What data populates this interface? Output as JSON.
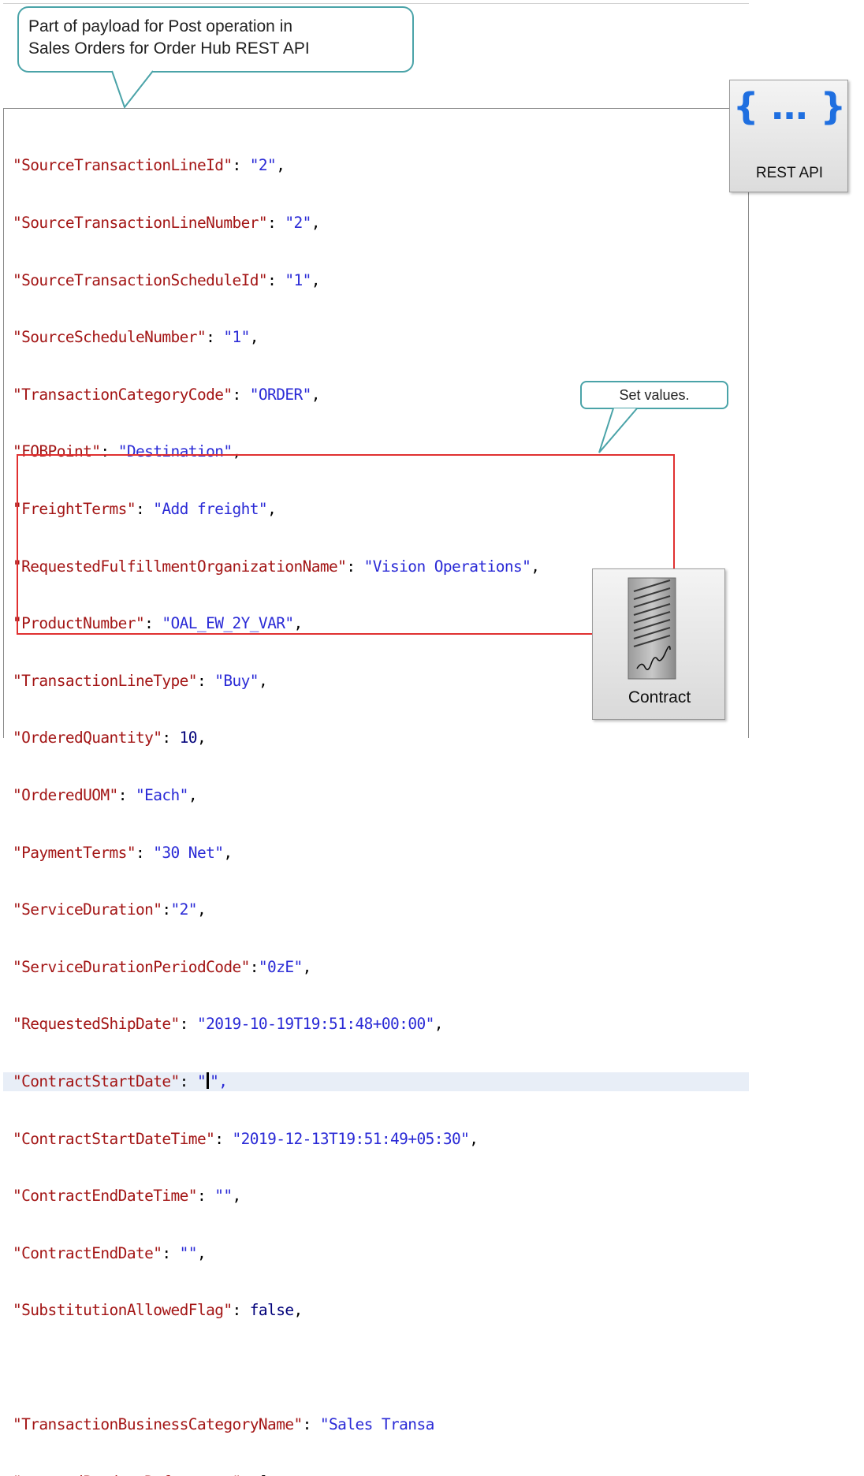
{
  "callouts": {
    "main_line1": "Part of payload for Post operation in",
    "main_line2": "Sales Orders for Order Hub REST API",
    "set_values": "Set values."
  },
  "tiles": {
    "rest_glyph": "{ … }",
    "rest_label": "REST API",
    "contract_label": "Contract",
    "rest_icon": "curly-braces-icon",
    "contract_icon": "signed-document-icon"
  },
  "colors": {
    "key": "#a31515",
    "string": "#2a2ad6",
    "callout_border": "#4aa3a8",
    "highlight_box": "#e03030",
    "rest_icon": "#1f6fe0"
  },
  "code": [
    {
      "key": "\"SourceTransactionLineId\"",
      "sep": ": ",
      "val": "\"2\"",
      "tail": ","
    },
    {
      "key": "\"SourceTransactionLineNumber\"",
      "sep": ": ",
      "val": "\"2\"",
      "tail": ","
    },
    {
      "key": "\"SourceTransactionScheduleId\"",
      "sep": ": ",
      "val": "\"1\"",
      "tail": ","
    },
    {
      "key": "\"SourceScheduleNumber\"",
      "sep": ": ",
      "val": "\"1\"",
      "tail": ","
    },
    {
      "key": "\"TransactionCategoryCode\"",
      "sep": ": ",
      "val": "\"ORDER\"",
      "tail": ","
    },
    {
      "key": "\"FOBPoint\"",
      "sep": ": ",
      "val": "\"Destination\"",
      "tail": ","
    },
    {
      "key": "\"FreightTerms\"",
      "sep": ": ",
      "val": "\"Add freight\"",
      "tail": ","
    },
    {
      "key": "\"RequestedFulfillmentOrganizationName\"",
      "sep": ": ",
      "val": "\"Vision Operations\"",
      "tail": ","
    },
    {
      "key": "\"ProductNumber\"",
      "sep": ": ",
      "val": "\"OAL_EW_2Y_VAR\"",
      "tail": ","
    },
    {
      "key": "\"TransactionLineType\"",
      "sep": ": ",
      "val": "\"Buy\"",
      "tail": ","
    },
    {
      "key": "\"OrderedQuantity\"",
      "sep": ": ",
      "val": "10",
      "tail": ","
    },
    {
      "key": "\"OrderedUOM\"",
      "sep": ": ",
      "val": "\"Each\"",
      "tail": ","
    },
    {
      "key": "\"PaymentTerms\"",
      "sep": ": ",
      "val": "\"30 Net\"",
      "tail": ","
    },
    {
      "key": "\"ServiceDuration\"",
      "sep": ":",
      "val": "\"2\"",
      "tail": ","
    },
    {
      "key": "\"ServiceDurationPeriodCode\"",
      "sep": ":",
      "val": "\"0zE\"",
      "tail": ","
    },
    {
      "key": "\"RequestedShipDate\"",
      "sep": ": ",
      "val": "\"2019-10-19T19:51:48+00:00\"",
      "tail": ","
    },
    {
      "key": "\"ContractStartDate\"",
      "sep": ": ",
      "val": "\"",
      "tail": "\","
    },
    {
      "key": "\"ContractStartDateTime\"",
      "sep": ": ",
      "val": "\"2019-12-13T19:51:49+05:30\"",
      "tail": ","
    },
    {
      "key": "\"ContractEndDateTime\"",
      "sep": ": ",
      "val": "\"\"",
      "tail": ","
    },
    {
      "key": "\"ContractEndDate\"",
      "sep": ": ",
      "val": "\"\"",
      "tail": ","
    },
    {
      "key": "\"SubstitutionAllowedFlag\"",
      "sep": ": ",
      "val": "false",
      "tail": ","
    },
    {
      "key": "",
      "sep": "",
      "val": "",
      "tail": ""
    },
    {
      "key": "\"TransactionBusinessCategoryName\"",
      "sep": ": ",
      "val": "\"Sales Transa",
      "tail": ""
    },
    {
      "key": "\"coveredProductReferences\"",
      "sep": ": ",
      "val": "",
      "tail": "["
    }
  ]
}
